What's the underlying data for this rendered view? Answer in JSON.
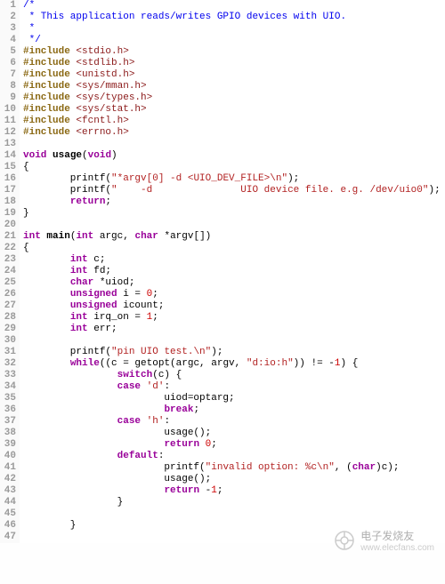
{
  "lines": [
    {
      "n": 1,
      "segments": [
        {
          "cls": "comment",
          "t": "/*"
        }
      ]
    },
    {
      "n": 2,
      "segments": [
        {
          "cls": "comment",
          "t": " * This application reads/writes GPIO devices with UIO."
        }
      ]
    },
    {
      "n": 3,
      "segments": [
        {
          "cls": "comment",
          "t": " *"
        }
      ]
    },
    {
      "n": 4,
      "segments": [
        {
          "cls": "comment",
          "t": " */"
        }
      ]
    },
    {
      "n": 5,
      "segments": [
        {
          "cls": "preprocessor",
          "t": "#include "
        },
        {
          "cls": "include-path",
          "t": "<stdio.h>"
        }
      ]
    },
    {
      "n": 6,
      "segments": [
        {
          "cls": "preprocessor",
          "t": "#include "
        },
        {
          "cls": "include-path",
          "t": "<stdlib.h>"
        }
      ]
    },
    {
      "n": 7,
      "segments": [
        {
          "cls": "preprocessor",
          "t": "#include "
        },
        {
          "cls": "include-path",
          "t": "<unistd.h>"
        }
      ]
    },
    {
      "n": 8,
      "segments": [
        {
          "cls": "preprocessor",
          "t": "#include "
        },
        {
          "cls": "include-path",
          "t": "<sys/mman.h>"
        }
      ]
    },
    {
      "n": 9,
      "segments": [
        {
          "cls": "preprocessor",
          "t": "#include "
        },
        {
          "cls": "include-path",
          "t": "<sys/types.h>"
        }
      ]
    },
    {
      "n": 10,
      "segments": [
        {
          "cls": "preprocessor",
          "t": "#include "
        },
        {
          "cls": "include-path",
          "t": "<sys/stat.h>"
        }
      ]
    },
    {
      "n": 11,
      "segments": [
        {
          "cls": "preprocessor",
          "t": "#include "
        },
        {
          "cls": "include-path",
          "t": "<fcntl.h>"
        }
      ]
    },
    {
      "n": 12,
      "segments": [
        {
          "cls": "preprocessor",
          "t": "#include "
        },
        {
          "cls": "include-path",
          "t": "<errno.h>"
        }
      ]
    },
    {
      "n": 13,
      "segments": []
    },
    {
      "n": 14,
      "segments": [
        {
          "cls": "type",
          "t": "void"
        },
        {
          "cls": "identifier",
          "t": " "
        },
        {
          "cls": "function-name",
          "t": "usage"
        },
        {
          "cls": "identifier",
          "t": "("
        },
        {
          "cls": "type",
          "t": "void"
        },
        {
          "cls": "identifier",
          "t": ")"
        }
      ]
    },
    {
      "n": 15,
      "segments": [
        {
          "cls": "brace",
          "t": "{"
        }
      ]
    },
    {
      "n": 16,
      "segments": [
        {
          "cls": "identifier",
          "t": "        printf("
        },
        {
          "cls": "string",
          "t": "\"*argv[0] -d <UIO_DEV_FILE>\\n\""
        },
        {
          "cls": "identifier",
          "t": ");"
        }
      ]
    },
    {
      "n": 17,
      "segments": [
        {
          "cls": "identifier",
          "t": "        printf("
        },
        {
          "cls": "string",
          "t": "\"    -d               UIO device file. e.g. /dev/uio0\""
        },
        {
          "cls": "identifier",
          "t": ");"
        }
      ]
    },
    {
      "n": 18,
      "segments": [
        {
          "cls": "identifier",
          "t": "        "
        },
        {
          "cls": "keyword",
          "t": "return"
        },
        {
          "cls": "identifier",
          "t": ";"
        }
      ]
    },
    {
      "n": 19,
      "segments": [
        {
          "cls": "brace",
          "t": "}"
        }
      ]
    },
    {
      "n": 20,
      "segments": []
    },
    {
      "n": 21,
      "segments": [
        {
          "cls": "type",
          "t": "int"
        },
        {
          "cls": "identifier",
          "t": " "
        },
        {
          "cls": "function-name",
          "t": "main"
        },
        {
          "cls": "identifier",
          "t": "("
        },
        {
          "cls": "type",
          "t": "int"
        },
        {
          "cls": "identifier",
          "t": " argc, "
        },
        {
          "cls": "type",
          "t": "char"
        },
        {
          "cls": "identifier",
          "t": " *argv[])"
        }
      ]
    },
    {
      "n": 22,
      "segments": [
        {
          "cls": "brace",
          "t": "{"
        }
      ]
    },
    {
      "n": 23,
      "segments": [
        {
          "cls": "identifier",
          "t": "        "
        },
        {
          "cls": "type",
          "t": "int"
        },
        {
          "cls": "identifier",
          "t": " c;"
        }
      ]
    },
    {
      "n": 24,
      "segments": [
        {
          "cls": "identifier",
          "t": "        "
        },
        {
          "cls": "type",
          "t": "int"
        },
        {
          "cls": "identifier",
          "t": " fd;"
        }
      ]
    },
    {
      "n": 25,
      "segments": [
        {
          "cls": "identifier",
          "t": "        "
        },
        {
          "cls": "type",
          "t": "char"
        },
        {
          "cls": "identifier",
          "t": " *uiod;"
        }
      ]
    },
    {
      "n": 26,
      "segments": [
        {
          "cls": "identifier",
          "t": "        "
        },
        {
          "cls": "type",
          "t": "unsigned"
        },
        {
          "cls": "identifier",
          "t": " i = "
        },
        {
          "cls": "number",
          "t": "0"
        },
        {
          "cls": "identifier",
          "t": ";"
        }
      ]
    },
    {
      "n": 27,
      "segments": [
        {
          "cls": "identifier",
          "t": "        "
        },
        {
          "cls": "type",
          "t": "unsigned"
        },
        {
          "cls": "identifier",
          "t": " icount;"
        }
      ]
    },
    {
      "n": 28,
      "segments": [
        {
          "cls": "identifier",
          "t": "        "
        },
        {
          "cls": "type",
          "t": "int"
        },
        {
          "cls": "identifier",
          "t": " irq_on = "
        },
        {
          "cls": "number",
          "t": "1"
        },
        {
          "cls": "identifier",
          "t": ";"
        }
      ]
    },
    {
      "n": 29,
      "segments": [
        {
          "cls": "identifier",
          "t": "        "
        },
        {
          "cls": "type",
          "t": "int"
        },
        {
          "cls": "identifier",
          "t": " err;"
        }
      ]
    },
    {
      "n": 30,
      "segments": []
    },
    {
      "n": 31,
      "segments": [
        {
          "cls": "identifier",
          "t": "        printf("
        },
        {
          "cls": "string",
          "t": "\"pin UIO test.\\n\""
        },
        {
          "cls": "identifier",
          "t": ");"
        }
      ]
    },
    {
      "n": 32,
      "segments": [
        {
          "cls": "identifier",
          "t": "        "
        },
        {
          "cls": "keyword",
          "t": "while"
        },
        {
          "cls": "identifier",
          "t": "((c = getopt(argc, argv, "
        },
        {
          "cls": "string",
          "t": "\"d:io:h\""
        },
        {
          "cls": "identifier",
          "t": ")) != -"
        },
        {
          "cls": "number",
          "t": "1"
        },
        {
          "cls": "identifier",
          "t": ") {"
        }
      ]
    },
    {
      "n": 33,
      "segments": [
        {
          "cls": "identifier",
          "t": "                "
        },
        {
          "cls": "keyword",
          "t": "switch"
        },
        {
          "cls": "identifier",
          "t": "(c) {"
        }
      ]
    },
    {
      "n": 34,
      "segments": [
        {
          "cls": "identifier",
          "t": "                "
        },
        {
          "cls": "keyword",
          "t": "case"
        },
        {
          "cls": "identifier",
          "t": " "
        },
        {
          "cls": "char-literal",
          "t": "'d'"
        },
        {
          "cls": "identifier",
          "t": ":"
        }
      ]
    },
    {
      "n": 35,
      "segments": [
        {
          "cls": "identifier",
          "t": "                        uiod=optarg;"
        }
      ]
    },
    {
      "n": 36,
      "segments": [
        {
          "cls": "identifier",
          "t": "                        "
        },
        {
          "cls": "keyword",
          "t": "break"
        },
        {
          "cls": "identifier",
          "t": ";"
        }
      ]
    },
    {
      "n": 37,
      "segments": [
        {
          "cls": "identifier",
          "t": "                "
        },
        {
          "cls": "keyword",
          "t": "case"
        },
        {
          "cls": "identifier",
          "t": " "
        },
        {
          "cls": "char-literal",
          "t": "'h'"
        },
        {
          "cls": "identifier",
          "t": ":"
        }
      ]
    },
    {
      "n": 38,
      "segments": [
        {
          "cls": "identifier",
          "t": "                        usage();"
        }
      ]
    },
    {
      "n": 39,
      "segments": [
        {
          "cls": "identifier",
          "t": "                        "
        },
        {
          "cls": "keyword",
          "t": "return"
        },
        {
          "cls": "identifier",
          "t": " "
        },
        {
          "cls": "number",
          "t": "0"
        },
        {
          "cls": "identifier",
          "t": ";"
        }
      ]
    },
    {
      "n": 40,
      "segments": [
        {
          "cls": "identifier",
          "t": "                "
        },
        {
          "cls": "keyword",
          "t": "default"
        },
        {
          "cls": "identifier",
          "t": ":"
        }
      ]
    },
    {
      "n": 41,
      "segments": [
        {
          "cls": "identifier",
          "t": "                        printf("
        },
        {
          "cls": "string",
          "t": "\"invalid option: %c\\n\""
        },
        {
          "cls": "identifier",
          "t": ", ("
        },
        {
          "cls": "type",
          "t": "char"
        },
        {
          "cls": "identifier",
          "t": ")c);"
        }
      ]
    },
    {
      "n": 42,
      "segments": [
        {
          "cls": "identifier",
          "t": "                        usage();"
        }
      ]
    },
    {
      "n": 43,
      "segments": [
        {
          "cls": "identifier",
          "t": "                        "
        },
        {
          "cls": "keyword",
          "t": "return"
        },
        {
          "cls": "identifier",
          "t": " -"
        },
        {
          "cls": "number",
          "t": "1"
        },
        {
          "cls": "identifier",
          "t": ";"
        }
      ]
    },
    {
      "n": 44,
      "segments": [
        {
          "cls": "identifier",
          "t": "                }"
        }
      ]
    },
    {
      "n": 45,
      "segments": []
    },
    {
      "n": 46,
      "segments": [
        {
          "cls": "identifier",
          "t": "        }"
        }
      ]
    },
    {
      "n": 47,
      "segments": []
    }
  ],
  "watermark": {
    "title": "电子发烧友",
    "url": "www.elecfans.com"
  }
}
